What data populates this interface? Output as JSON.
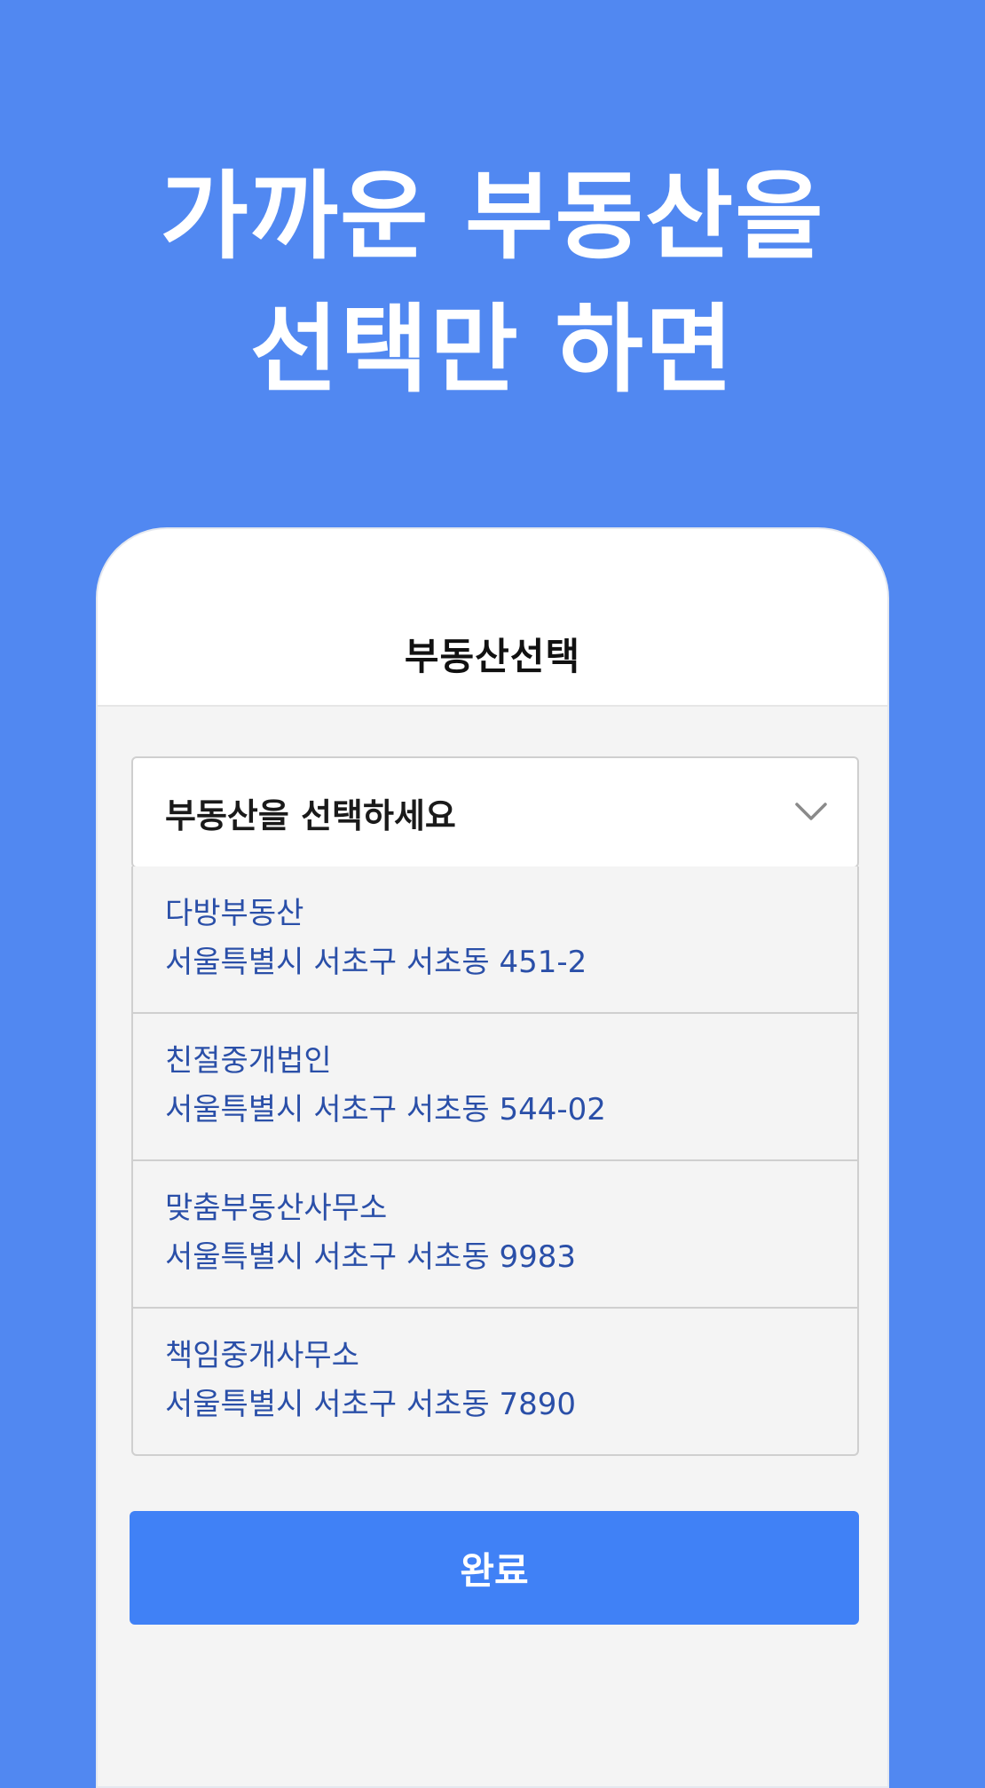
{
  "headline": {
    "line1": "가까운 부동산을",
    "line2": "선택만 하면"
  },
  "nav": {
    "title": "부동산선택"
  },
  "select": {
    "label": "부동산을 선택하세요",
    "icon": "chevron-down-icon"
  },
  "options": [
    {
      "name": "다방부동산",
      "address": "서울특별시 서초구 서초동 451-2"
    },
    {
      "name": "친절중개법인",
      "address": "서울특별시 서초구 서초동 544-02"
    },
    {
      "name": "맞춤부동산사무소",
      "address": "서울특별시 서초구 서초동 9983"
    },
    {
      "name": "책임중개사무소",
      "address": "서울특별시 서초구 서초동 7890"
    }
  ],
  "done_button": {
    "label": "완료"
  },
  "colors": {
    "background": "#5188f1",
    "button": "#4081f6",
    "option_text": "#2a4fa8"
  }
}
